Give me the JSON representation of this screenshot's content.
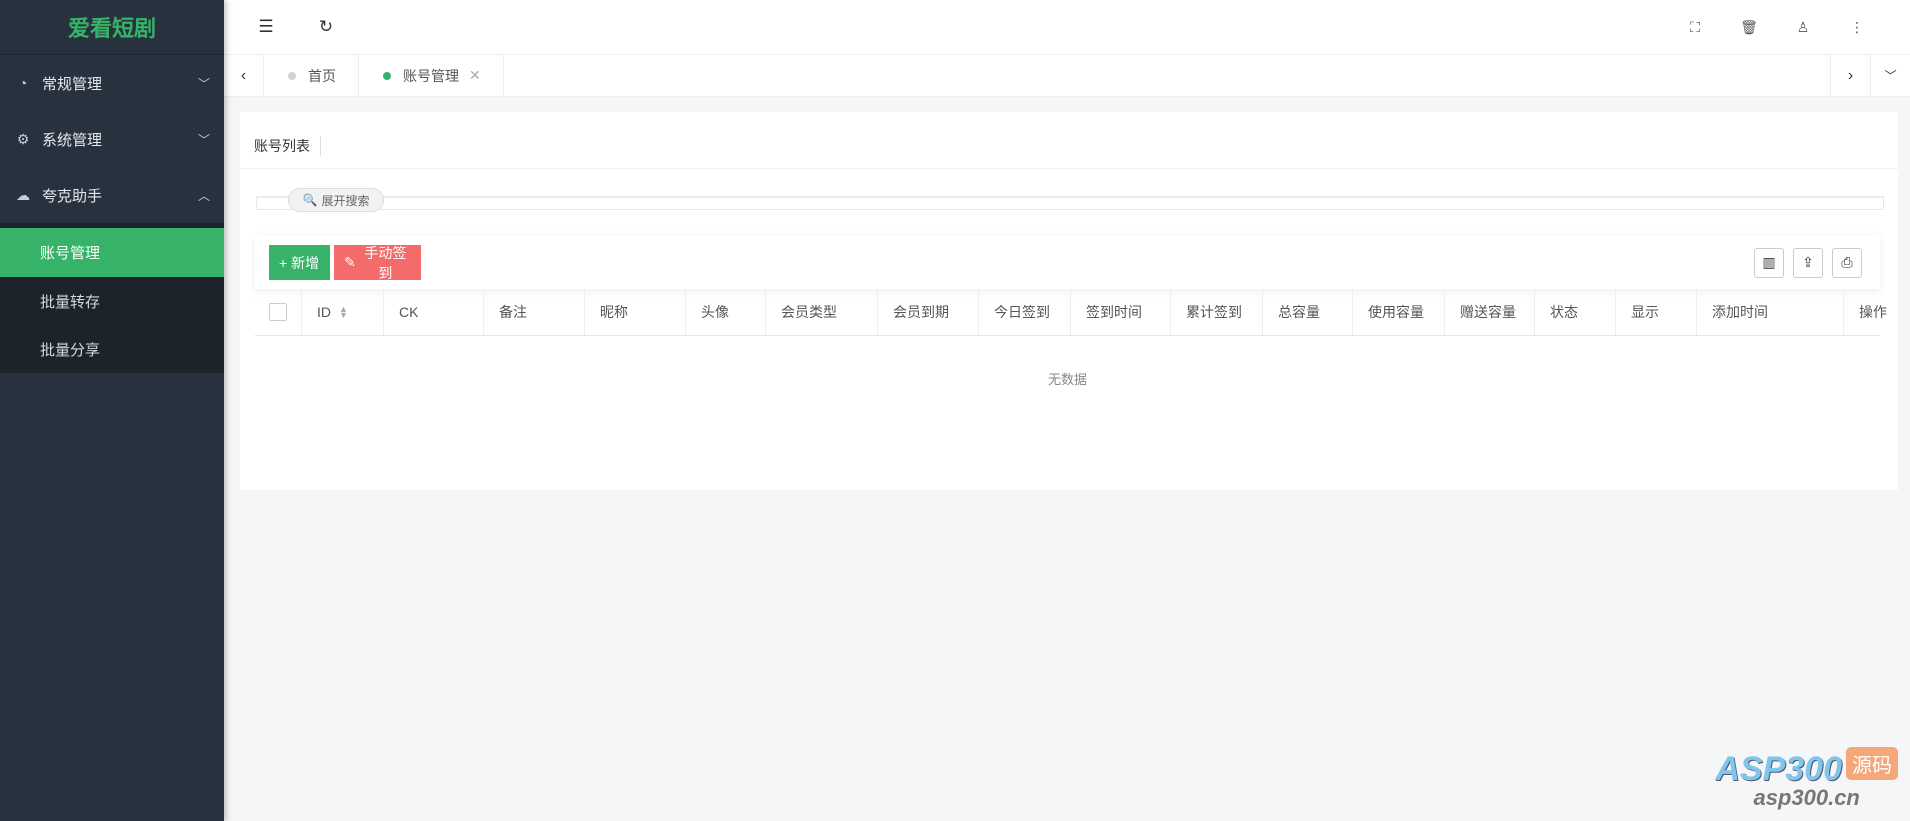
{
  "app": {
    "logo": "爱看短剧"
  },
  "sidebar": {
    "items": [
      {
        "label": "常规管理",
        "icon": "dashboard-icon",
        "expanded": false
      },
      {
        "label": "系统管理",
        "icon": "gear-icon",
        "expanded": false
      },
      {
        "label": "夸克助手",
        "icon": "cloud-upload-icon",
        "expanded": true
      }
    ],
    "submenu": [
      {
        "label": "账号管理",
        "active": true
      },
      {
        "label": "批量转存"
      },
      {
        "label": "批量分享"
      }
    ]
  },
  "header": {
    "icons": [
      "menu-fold-icon",
      "refresh-icon",
      "fullscreen-icon",
      "trash-icon",
      "user-icon",
      "more-vertical-icon"
    ]
  },
  "tabs": [
    {
      "label": "首页"
    },
    {
      "label": "账号管理",
      "active": true,
      "closable": true
    }
  ],
  "card": {
    "title": "账号列表",
    "search_toggle": "展开搜索"
  },
  "toolbar": {
    "add_label": "+ 新增",
    "sign_label": "手动签到",
    "tools": [
      "columns-icon",
      "export-icon",
      "print-icon"
    ]
  },
  "table": {
    "columns": [
      "ID",
      "CK",
      "备注",
      "昵称",
      "头像",
      "会员类型",
      "会员到期",
      "今日签到",
      "签到时间",
      "累计签到",
      "总容量",
      "使用容量",
      "赠送容量",
      "状态",
      "显示",
      "添加时间",
      "操作"
    ],
    "empty_text": "无数据"
  },
  "watermark": {
    "brand": "ASP300",
    "badge": "源码",
    "url": "asp300.cn"
  },
  "colors": {
    "accent": "#36b368",
    "danger": "#f36b6b",
    "sidebar": "#28323e"
  }
}
